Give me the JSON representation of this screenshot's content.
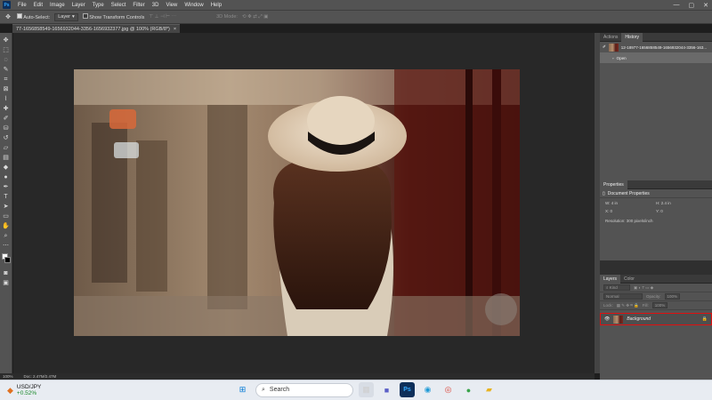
{
  "menubar": {
    "logo": "Ps",
    "items": [
      "File",
      "Edit",
      "Image",
      "Layer",
      "Type",
      "Select",
      "Filter",
      "3D",
      "View",
      "Window",
      "Help"
    ],
    "window_controls": [
      "—",
      "▢",
      "✕"
    ]
  },
  "options_bar": {
    "auto_select_label": "Auto-Select:",
    "auto_select_value": "Layer",
    "transform_label": "Show Transform Controls",
    "mode_label": "3D Mode:"
  },
  "document": {
    "tab_title": "77-1656858549-1656932044-3356-1656932377.jpg @ 100% (RGB/8*)",
    "close": "×"
  },
  "statusbar": {
    "zoom": "100%",
    "doc_size": "Doc: 2.47M/2.47M"
  },
  "history_panel": {
    "tabs": [
      "Actions",
      "History"
    ],
    "active_tab": "History",
    "snapshot_label": "12-18977-1656858549-1656932044-3356-163...",
    "open_label": "Open"
  },
  "properties_panel": {
    "tab": "Properties",
    "title": "Document Properties",
    "w_label": "W:",
    "w_value": "4 in",
    "h_label": "H:",
    "h_value": "2.4 in",
    "x_label": "X:",
    "x_value": "0",
    "y_label": "Y:",
    "y_value": "0",
    "resolution": "Resolution: 300 pixels/inch"
  },
  "layers_panel": {
    "tabs": [
      "Layers",
      "Color"
    ],
    "active_tab": "Layers",
    "kind_placeholder": "Kind",
    "blend_mode": "Normal",
    "opacity_label": "Opacity:",
    "opacity_value": "100%",
    "lock_label": "Lock:",
    "fill_label": "Fill:",
    "fill_value": "100%",
    "layer_name": "Background",
    "highlight_color": "#e01010"
  },
  "taskbar": {
    "ticker": "USD/JPY",
    "ticker_change": "+0.52%",
    "search_label": "Search"
  }
}
